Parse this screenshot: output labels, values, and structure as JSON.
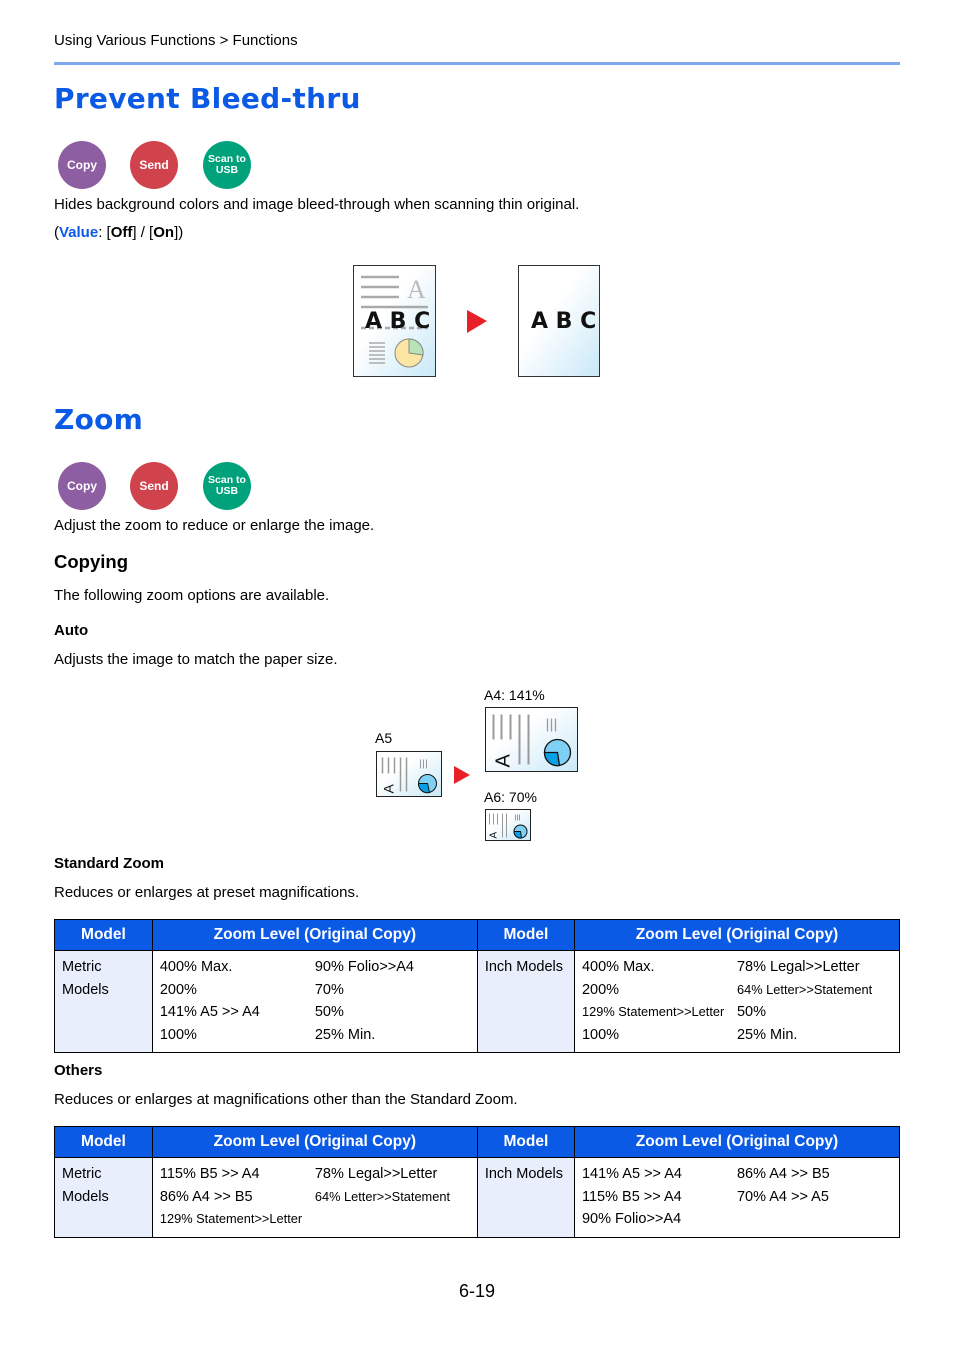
{
  "breadcrumb": "Using Various Functions > Functions",
  "sections": {
    "bleed": {
      "title": "Prevent Bleed-thru",
      "badges": {
        "copy": "Copy",
        "send": "Send",
        "usb_line1": "Scan to",
        "usb_line2": "USB"
      },
      "description": "Hides background colors and image bleed-through when scanning thin original.",
      "value_open": "(",
      "value_label": "Value",
      "value_sep": ": [",
      "value_off": "Off",
      "value_mid": "] / [",
      "value_on": "On",
      "value_close": "])",
      "illustration": {
        "before_text": "A B C",
        "after_text": "A B C",
        "ghost_letter": "A"
      }
    },
    "zoom": {
      "title": "Zoom",
      "badges": {
        "copy": "Copy",
        "send": "Send",
        "usb_line1": "Scan to",
        "usb_line2": "USB"
      },
      "description": "Adjust the zoom to reduce or enlarge the image.",
      "copying_heading": "Copying",
      "copying_text": "The following zoom options are available.",
      "auto_heading": "Auto",
      "auto_text": "Adjusts the image to match the paper size.",
      "auto_diagram": {
        "source": "A5",
        "large": "A4: 141%",
        "small": "A6: 70%",
        "letter": "A"
      },
      "standard_heading": "Standard Zoom",
      "standard_text": "Reduces or enlarges at preset magnifications.",
      "others_heading": "Others",
      "others_text": "Reduces or enlarges at magnifications other than the Standard Zoom."
    }
  },
  "tables": {
    "headers": [
      "Model",
      "Zoom Level (Original Copy)",
      "Model",
      "Zoom Level (Original Copy)"
    ],
    "standard": {
      "metric_label": "Metric Models",
      "metric_col1": [
        "400% Max.",
        "200%",
        "141% A5 >> A4",
        "100%"
      ],
      "metric_col2": [
        "90% Folio>>A4",
        "70%",
        "50%",
        "25% Min."
      ],
      "inch_label": "Inch Models",
      "inch_col1": [
        "400% Max.",
        "200%",
        "129% Statement>>Letter",
        "100%"
      ],
      "inch_col2": [
        "78% Legal>>Letter",
        "64% Letter>>Statement",
        "50%",
        "25% Min."
      ]
    },
    "others": {
      "metric_label": "Metric Models",
      "metric_col1": [
        "115% B5 >> A4",
        "86% A4 >> B5",
        "129% Statement>>Letter"
      ],
      "metric_col2": [
        "78% Legal>>Letter",
        "64% Letter>>Statement"
      ],
      "inch_label": "Inch Models",
      "inch_col1": [
        "141% A5 >> A4",
        "115% B5 >> A4",
        "90% Folio>>A4"
      ],
      "inch_col2": [
        "86% A4 >> B5",
        "70% A4 >> A5"
      ]
    }
  },
  "colors": {
    "heading_blue": "#0b5ae6",
    "copy": "#8e5ea2",
    "send": "#d0434d",
    "scan_usb": "#00a27c",
    "arrow_red": "#e8202a"
  },
  "page_number": "6-19"
}
